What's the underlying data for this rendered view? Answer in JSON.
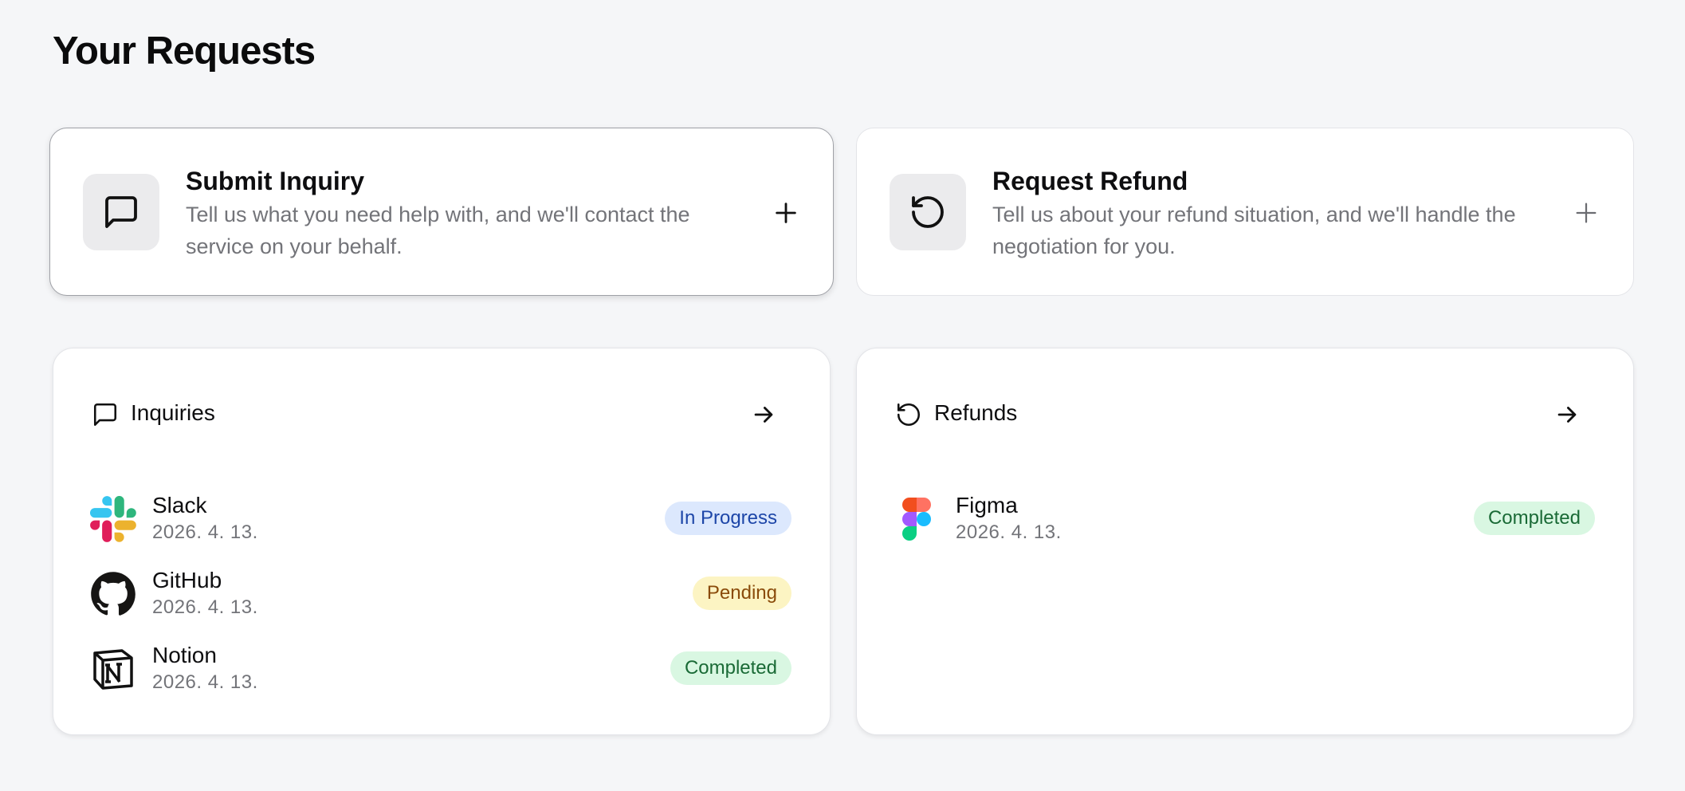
{
  "page": {
    "title": "Your Requests"
  },
  "actions": {
    "inquiry": {
      "icon": "message-square-icon",
      "title": "Submit Inquiry",
      "description": "Tell us what you need help with, and we'll contact the service on your behalf.",
      "add_icon": "plus-icon"
    },
    "refund": {
      "icon": "rotate-ccw-icon",
      "title": "Request Refund",
      "description": "Tell us about your refund situation, and we'll handle the negotiation for you.",
      "add_icon": "plus-icon"
    }
  },
  "lists": {
    "inquiries": {
      "label": "Inquiries",
      "icon": "message-square-icon",
      "items": [
        {
          "service": "Slack",
          "date": "2026. 4. 13.",
          "status": "In Progress",
          "logo": "slack-logo"
        },
        {
          "service": "GitHub",
          "date": "2026. 4. 13.",
          "status": "Pending",
          "logo": "github-logo"
        },
        {
          "service": "Notion",
          "date": "2026. 4. 13.",
          "status": "Completed",
          "logo": "notion-logo"
        }
      ]
    },
    "refunds": {
      "label": "Refunds",
      "icon": "rotate-ccw-icon",
      "items": [
        {
          "service": "Figma",
          "date": "2026. 4. 13.",
          "status": "Completed",
          "logo": "figma-logo"
        }
      ]
    }
  },
  "colors": {
    "background": "#f5f6f8",
    "status_in_progress": "#dce8fd",
    "status_pending": "#fcf4c3",
    "status_completed": "#d9f7e2"
  }
}
